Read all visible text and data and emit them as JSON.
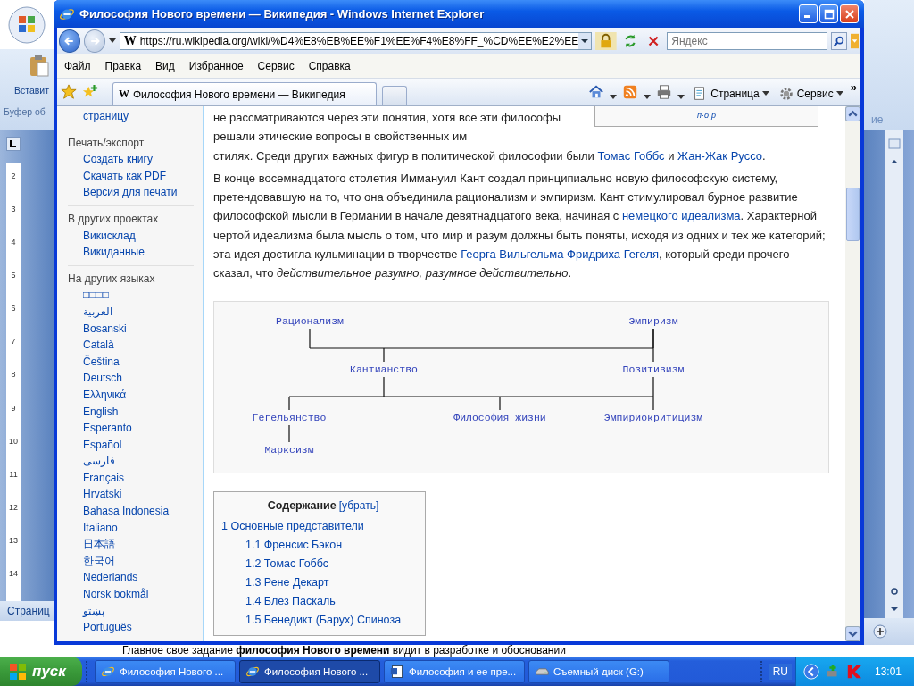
{
  "word": {
    "paste_label": "Вставит",
    "group_label": "Буфер об",
    "ribbon_tail": "ие",
    "ruler_numbers": [
      "2",
      "3",
      "4",
      "5",
      "6",
      "7",
      "8",
      "9",
      "10",
      "11",
      "12",
      "13",
      "14"
    ],
    "status": "Страниц",
    "body_line": "Главное свое задание **философия Нового времени** видит в разработке и обосновании"
  },
  "browser": {
    "title": "Философия Нового времени — Википедия - Windows Internet Explorer",
    "site_icon": "W",
    "url": "https://ru.wikipedia.org/wiki/%D4%E8%EB%EE%F1%EE%F4%E8%FF_%CD%EE%E2%EE",
    "search_placeholder": "Яндекс",
    "menu": [
      "Файл",
      "Правка",
      "Вид",
      "Избранное",
      "Сервис",
      "Справка"
    ],
    "tabs": [
      {
        "icon": "W",
        "label": "Философия Нового времени — Википедия",
        "selected": true
      }
    ],
    "commands": [
      "Страница",
      "Сервис"
    ],
    "overflow": "»"
  },
  "sidebar": {
    "groups": [
      {
        "items": [
          "страницу"
        ]
      },
      {
        "heading": "Печать/экспорт",
        "items": [
          "Создать книгу",
          "Скачать как PDF",
          "Версия для печати"
        ]
      },
      {
        "heading": "В других проектах",
        "items": [
          "Викисклад",
          "Викиданные"
        ]
      },
      {
        "heading": "На других языках",
        "items": [
          "□□□□",
          "العربية",
          "Bosanski",
          "Català",
          "Čeština",
          "Deutsch",
          "Ελληνικά",
          "English",
          "Esperanto",
          "Español",
          "فارسی",
          "Français",
          "Hrvatski",
          "Bahasa Indonesia",
          "Italiano",
          "日本語",
          "한국어",
          "Nederlands",
          "Norsk bokmål",
          "پښتو",
          "Português"
        ]
      }
    ]
  },
  "article": {
    "infobox_links": "п·о·р",
    "lead_text": "не рассматриваются через эти понятия, хотя все эти философы решали этические вопросы в свойственных им",
    "paragraphs": [
      [
        {
          "kind": "text",
          "text": "стилях. Среди других важных фигур в политической философии были "
        },
        {
          "kind": "link",
          "text": "Томас Гоббс"
        },
        {
          "kind": "text",
          "text": " и "
        },
        {
          "kind": "link",
          "text": "Жан-Жак Руссо"
        },
        {
          "kind": "text",
          "text": "."
        }
      ],
      [
        {
          "kind": "text",
          "text": "В конце восемнадцатого столетия Иммануил Кант создал принципиально новую философскую систему, претендовавшую на то, что она объединила рационализм и эмпиризм. Кант стимулировал бурное развитие философской мысли в Германии в начале девятнадцатого века, начиная с "
        },
        {
          "kind": "link",
          "text": "немецкого идеализма"
        },
        {
          "kind": "text",
          "text": ". Характерной чертой идеализма была мысль о том, что мир и разум должны быть поняты, исходя из одних и тех же категорий; эта идея достигла кульминации в творчестве "
        },
        {
          "kind": "link",
          "text": "Георга Вильгельма Фридриха Гегеля"
        },
        {
          "kind": "text",
          "text": ", который среди прочего сказал, что "
        },
        {
          "kind": "italic",
          "text": "действительное разумно, разумное действительно"
        },
        {
          "kind": "text",
          "text": "."
        }
      ]
    ]
  },
  "diagram": {
    "nodes": [
      "Рационализм",
      "Эмпиризм",
      "Кантианство",
      "Позитивизм",
      "Гегельянство",
      "Философия жизни",
      "Эмпириокритицизм",
      "Марксизм"
    ]
  },
  "toc": {
    "title": "Содержание",
    "toggle": "[убрать]",
    "items": [
      {
        "label": "1 Основные представители",
        "children": [
          "1.1 Френсис Бэкон",
          "1.2 Томас Гоббс",
          "1.3 Рене Декарт",
          "1.4 Блез Паскаль",
          "1.5 Бенедикт (Барух) Спиноза"
        ]
      }
    ]
  },
  "taskbar": {
    "start": "пуск",
    "tasks": [
      {
        "kind": "ie",
        "label": "Философия Нового ...",
        "selected": false
      },
      {
        "kind": "ie",
        "label": "Философия Нового ...",
        "selected": true
      },
      {
        "kind": "word",
        "label": "Философия и ее пре...",
        "selected": false
      },
      {
        "kind": "drive",
        "label": "Съемный диск (G:)",
        "selected": false
      }
    ],
    "language": "RU",
    "clock": "13:01"
  }
}
